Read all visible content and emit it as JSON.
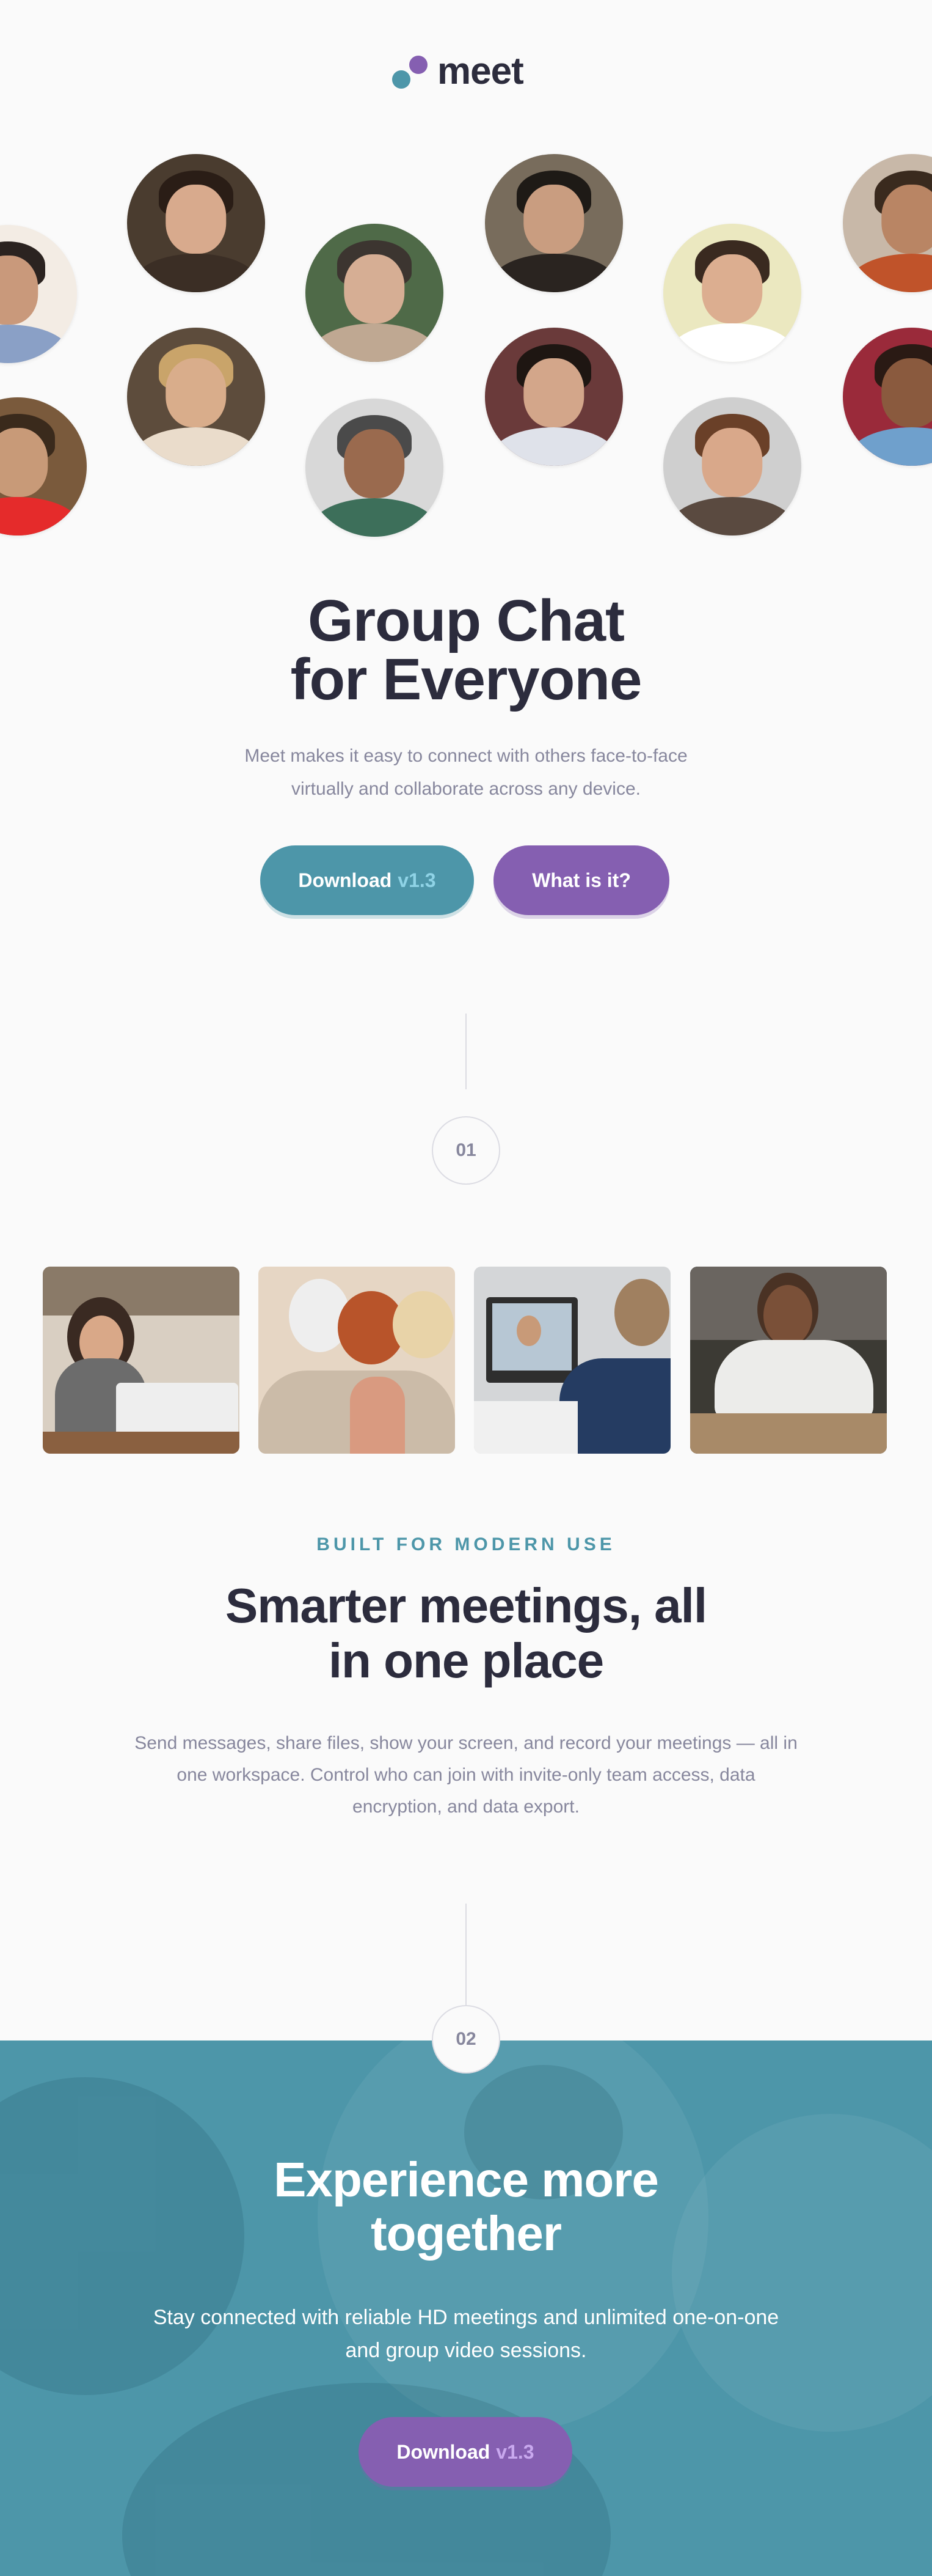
{
  "brand": {
    "name": "meet",
    "colors": {
      "teal": "#4d96a9",
      "purple": "#855fb1",
      "dark": "#2c2c3d",
      "gray": "#87879d"
    }
  },
  "hero": {
    "title_line1": "Group Chat",
    "title_line2": "for Everyone",
    "description_line1": "Meet makes it easy to connect with others face-to-face",
    "description_line2": "virtually and collaborate across any device.",
    "download_label": "Download",
    "download_version": "v1.3",
    "what_label": "What is it?"
  },
  "avatars": [
    "portrait",
    "portrait",
    "portrait",
    "portrait",
    "portrait",
    "portrait",
    "portrait",
    "portrait",
    "portrait",
    "portrait",
    "portrait",
    "portrait"
  ],
  "steps": {
    "first": "01",
    "second": "02"
  },
  "photos": [
    "woman-on-laptop",
    "friends-with-phone",
    "video-call-on-laptop",
    "man-on-phone"
  ],
  "features": {
    "eyebrow": "BUILT FOR MODERN USE",
    "title_line1": "Smarter meetings, all",
    "title_line2": "in one place",
    "description_line1": "Send messages, share files, show your screen, and record your meetings — all in",
    "description_line2": "one workspace. Control who can join with invite-only team access, data",
    "description_line3": "encryption, and data export."
  },
  "cta": {
    "title_line1": "Experience more",
    "title_line2": "together",
    "description_line1": "Stay connected with reliable HD meetings and unlimited one-on-one",
    "description_line2": "and group video sessions.",
    "download_label": "Download",
    "download_version": "v1.3"
  }
}
